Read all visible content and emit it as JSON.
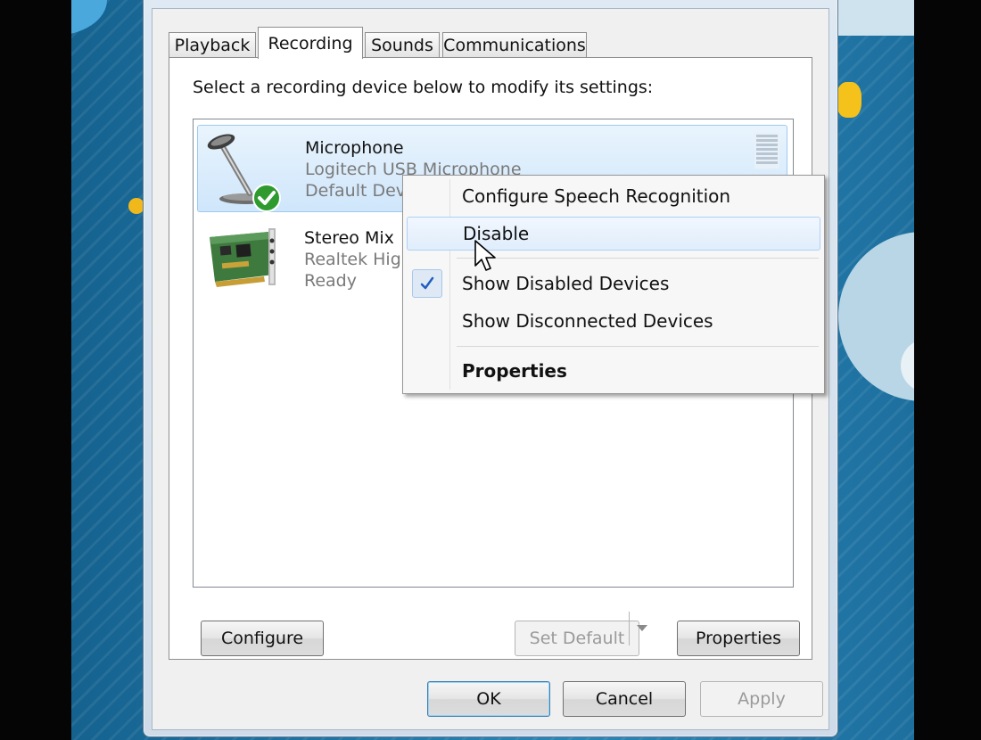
{
  "dialog": {
    "tabs": [
      {
        "label": "Playback"
      },
      {
        "label": "Recording"
      },
      {
        "label": "Sounds"
      },
      {
        "label": "Communications"
      }
    ],
    "active_tab": "Recording",
    "instruction": "Select a recording device below to modify its settings:",
    "devices": [
      {
        "name": "Microphone",
        "description": "Logitech USB Microphone",
        "status": "Default Device",
        "icon": "microphone-icon",
        "selected": true,
        "default": true
      },
      {
        "name": "Stereo Mix",
        "description": "Realtek High Definition Audio",
        "status": "Ready",
        "icon": "sound-card-icon",
        "selected": false
      }
    ],
    "buttons": {
      "configure": "Configure",
      "set_default": "Set Default",
      "properties": "Properties",
      "ok": "OK",
      "cancel": "Cancel",
      "apply": "Apply"
    }
  },
  "context_menu": {
    "items": [
      {
        "label": "Configure Speech Recognition"
      },
      {
        "label": "Disable",
        "hovered": true
      },
      {
        "label": "Show Disabled Devices",
        "checked": true
      },
      {
        "label": "Show Disconnected Devices"
      },
      {
        "label": "Properties",
        "bold": true
      }
    ]
  },
  "colors": {
    "selection": "#cfe6fb",
    "default_badge": "#2f9b2f",
    "check": "#1f5fbf",
    "desktop": "#1b6e9c"
  }
}
